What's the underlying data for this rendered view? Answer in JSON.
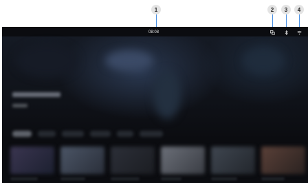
{
  "callouts": [
    "1",
    "2",
    "3",
    "4"
  ],
  "status_bar": {
    "time": "08:08",
    "icons": [
      "notifications-icon",
      "bluetooth-icon",
      "wifi-icon"
    ]
  },
  "colors": {
    "background": "#0b0c10",
    "callout_bg": "#e4e4e4",
    "leader_line": "#4a90e2",
    "status_text": "#e8e8e8"
  }
}
